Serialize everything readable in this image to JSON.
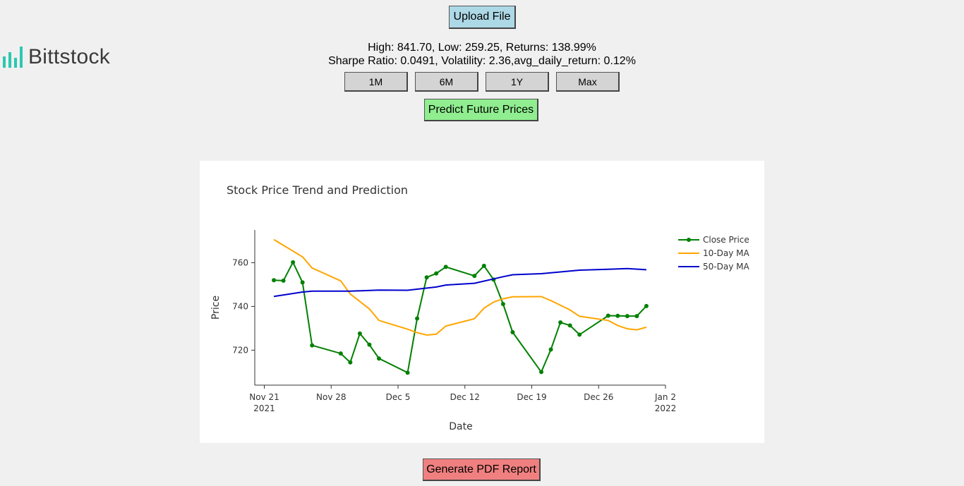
{
  "brand": {
    "name": "Bittstock",
    "color": "#2dc7b0"
  },
  "buttons": {
    "upload": "Upload File",
    "predict": "Predict Future Prices",
    "pdf": "Generate PDF Report"
  },
  "stats": {
    "line1": "High: 841.70, Low: 259.25, Returns: 138.99%",
    "line2": "Sharpe Ratio: 0.0491, Volatility: 2.36,avg_daily_return: 0.12%"
  },
  "ranges": [
    "1M",
    "6M",
    "1Y",
    "Max"
  ],
  "chart_data": {
    "type": "line",
    "title": "Stock Price Trend and Prediction",
    "xlabel": "Date",
    "ylabel": "Price",
    "x_range": [
      "2021-11-20",
      "2022-01-02"
    ],
    "y_range": [
      704,
      775
    ],
    "y_ticks": [
      720,
      740,
      760
    ],
    "x_ticks": [
      {
        "date": "2021-11-21",
        "label": "Nov 21",
        "label2": "2021"
      },
      {
        "date": "2021-11-28",
        "label": "Nov 28",
        "label2": ""
      },
      {
        "date": "2021-12-05",
        "label": "Dec 5",
        "label2": ""
      },
      {
        "date": "2021-12-12",
        "label": "Dec 12",
        "label2": ""
      },
      {
        "date": "2021-12-19",
        "label": "Dec 19",
        "label2": ""
      },
      {
        "date": "2021-12-26",
        "label": "Dec 26",
        "label2": ""
      },
      {
        "date": "2022-01-02",
        "label": "Jan 2",
        "label2": "2022"
      }
    ],
    "grid": false,
    "legend": "top-right",
    "series": [
      {
        "name": "Close Price",
        "color": "#008000",
        "markers": true,
        "points": [
          [
            "2021-11-22",
            752
          ],
          [
            "2021-11-23",
            751.8
          ],
          [
            "2021-11-24",
            760.2
          ],
          [
            "2021-11-25",
            751
          ],
          [
            "2021-11-26",
            722.2
          ],
          [
            "2021-11-29",
            718.5
          ],
          [
            "2021-11-30",
            714.4
          ],
          [
            "2021-12-01",
            727.6
          ],
          [
            "2021-12-02",
            722.5
          ],
          [
            "2021-12-03",
            716.2
          ],
          [
            "2021-12-06",
            709.7
          ],
          [
            "2021-12-07",
            734.5
          ],
          [
            "2021-12-08",
            753.3
          ],
          [
            "2021-12-09",
            755.1
          ],
          [
            "2021-12-10",
            758.1
          ],
          [
            "2021-12-13",
            754
          ],
          [
            "2021-12-14",
            758.6
          ],
          [
            "2021-12-15",
            752.3
          ],
          [
            "2021-12-16",
            741.1
          ],
          [
            "2021-12-17",
            728.2
          ],
          [
            "2021-12-20",
            710
          ],
          [
            "2021-12-21",
            720.3
          ],
          [
            "2021-12-22",
            732.7
          ],
          [
            "2021-12-23",
            731.3
          ],
          [
            "2021-12-24",
            727.1
          ],
          [
            "2021-12-27",
            735.8
          ],
          [
            "2021-12-28",
            735.7
          ],
          [
            "2021-12-29",
            735.6
          ],
          [
            "2021-12-30",
            735.6
          ],
          [
            "2021-12-31",
            740.2
          ]
        ]
      },
      {
        "name": "10-Day MA",
        "color": "#ffa500",
        "markers": false,
        "points": [
          [
            "2021-11-22",
            770.6
          ],
          [
            "2021-11-25",
            762.7
          ],
          [
            "2021-11-26",
            757.6
          ],
          [
            "2021-11-29",
            751.7
          ],
          [
            "2021-11-30",
            745.7
          ],
          [
            "2021-12-02",
            738.9
          ],
          [
            "2021-12-03",
            733.6
          ],
          [
            "2021-12-06",
            729.6
          ],
          [
            "2021-12-07",
            728
          ],
          [
            "2021-12-08",
            726.9
          ],
          [
            "2021-12-09",
            727.3
          ],
          [
            "2021-12-10",
            731
          ],
          [
            "2021-12-13",
            734.4
          ],
          [
            "2021-12-14",
            739.2
          ],
          [
            "2021-12-15",
            742
          ],
          [
            "2021-12-16",
            743.5
          ],
          [
            "2021-12-17",
            744.4
          ],
          [
            "2021-12-20",
            744.5
          ],
          [
            "2021-12-21",
            742.7
          ],
          [
            "2021-12-23",
            738.4
          ],
          [
            "2021-12-24",
            735.5
          ],
          [
            "2021-12-27",
            733.6
          ],
          [
            "2021-12-28",
            731.3
          ],
          [
            "2021-12-29",
            729.8
          ],
          [
            "2021-12-30",
            729.3
          ],
          [
            "2021-12-31",
            730.5
          ]
        ]
      },
      {
        "name": "50-Day MA",
        "color": "#0000cd",
        "markers": false,
        "points": [
          [
            "2021-11-22",
            744.6
          ],
          [
            "2021-11-25",
            746.6
          ],
          [
            "2021-11-26",
            747
          ],
          [
            "2021-11-30",
            747
          ],
          [
            "2021-12-03",
            747.5
          ],
          [
            "2021-12-06",
            747.4
          ],
          [
            "2021-12-09",
            748.9
          ],
          [
            "2021-12-10",
            749.8
          ],
          [
            "2021-12-13",
            750.6
          ],
          [
            "2021-12-16",
            753.6
          ],
          [
            "2021-12-17",
            754.5
          ],
          [
            "2021-12-20",
            755
          ],
          [
            "2021-12-24",
            756.6
          ],
          [
            "2021-12-27",
            757
          ],
          [
            "2021-12-29",
            757.3
          ],
          [
            "2021-12-31",
            756.8
          ]
        ]
      }
    ]
  }
}
